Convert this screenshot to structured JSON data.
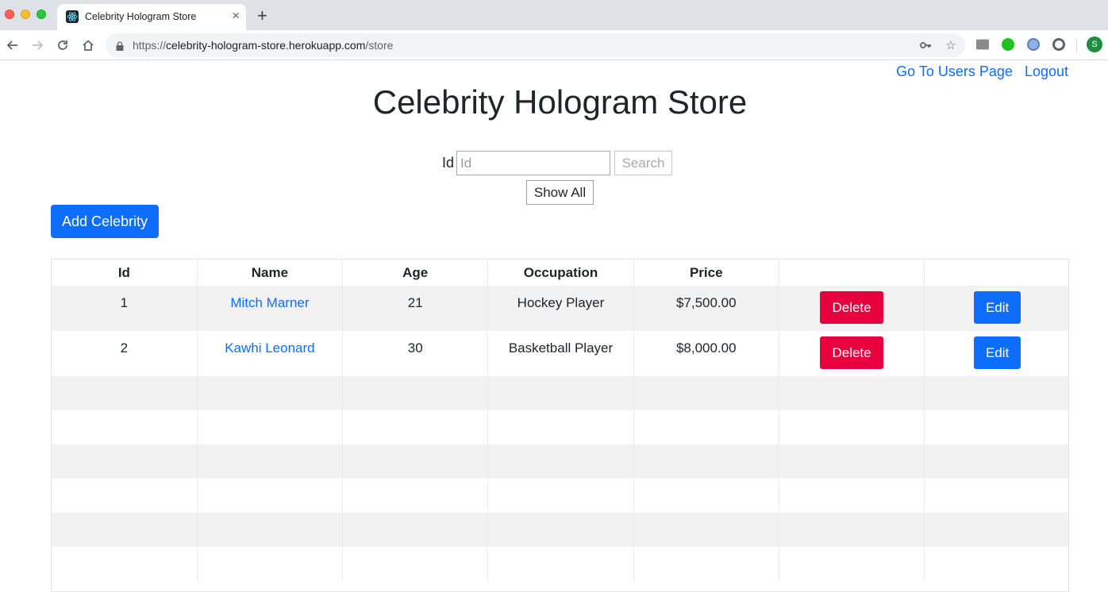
{
  "browser": {
    "tab_title": "Celebrity Hologram Store",
    "url_scheme": "https://",
    "url_host": "celebrity-hologram-store.herokuapp.com",
    "url_path": "/store",
    "profile_initial": "S"
  },
  "header": {
    "users_link": "Go To Users Page",
    "logout_link": "Logout",
    "title": "Celebrity Hologram Store"
  },
  "search": {
    "label": "Id",
    "placeholder": "Id",
    "value": "",
    "search_label": "Search",
    "show_all_label": "Show All"
  },
  "actions": {
    "add_label": "Add Celebrity"
  },
  "table": {
    "columns": [
      "Id",
      "Name",
      "Age",
      "Occupation",
      "Price",
      "",
      ""
    ],
    "rows": [
      {
        "id": "1",
        "name": "Mitch Marner",
        "age": "21",
        "occupation": "Hockey Player",
        "price": "$7,500.00",
        "delete_label": "Delete",
        "edit_label": "Edit"
      },
      {
        "id": "2",
        "name": "Kawhi Leonard",
        "age": "30",
        "occupation": "Basketball Player",
        "price": "$8,000.00",
        "delete_label": "Delete",
        "edit_label": "Edit"
      }
    ]
  },
  "colors": {
    "primary": "#0d6efd",
    "danger": "#e8003e",
    "row_stripe": "#f2f2f2"
  }
}
